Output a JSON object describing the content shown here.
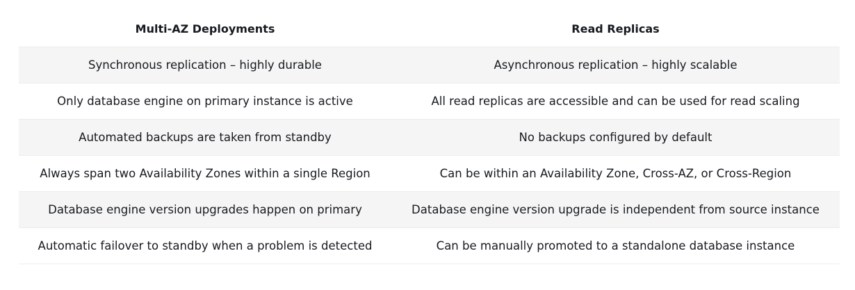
{
  "table": {
    "headers": [
      "Multi-AZ Deployments",
      "Read Replicas"
    ],
    "rows": [
      [
        "Synchronous replication – highly durable",
        "Asynchronous replication – highly scalable"
      ],
      [
        "Only database engine on primary instance is active",
        "All read replicas are accessible and can be used for read scaling"
      ],
      [
        "Automated backups are taken from standby",
        "No backups configured by default"
      ],
      [
        "Always span two Availability Zones within a single Region",
        "Can be within an Availability Zone, Cross-AZ, or Cross-Region"
      ],
      [
        "Database engine version upgrades happen on primary",
        "Database engine version upgrade is independent from source instance"
      ],
      [
        "Automatic failover to standby when a problem is detected",
        "Can be manually promoted to a standalone database instance"
      ]
    ]
  },
  "colors": {
    "text": "#16191f",
    "stripe": "#f5f5f5",
    "divider": "#eaeded"
  }
}
